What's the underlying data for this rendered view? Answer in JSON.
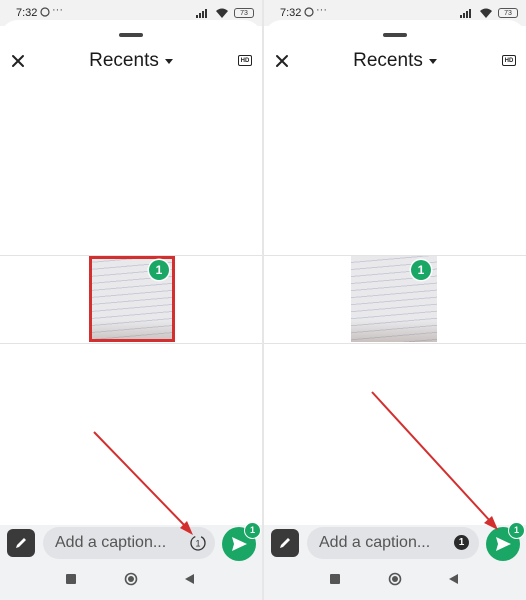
{
  "panels": [
    {
      "status_bar": {
        "time": "7:32",
        "dots": "···",
        "battery": "73"
      },
      "header": {
        "title": "Recents",
        "hd_label": "HD"
      },
      "selection_count": "1",
      "caption": {
        "placeholder": "Add a caption..."
      },
      "send_badge": "1",
      "view_once": {
        "mode": "outline",
        "label": "1"
      },
      "thumbnail_highlighted": true
    },
    {
      "status_bar": {
        "time": "7:32",
        "dots": "···",
        "battery": "73"
      },
      "header": {
        "title": "Recents",
        "hd_label": "HD"
      },
      "selection_count": "1",
      "caption": {
        "placeholder": "Add a caption..."
      },
      "send_badge": "1",
      "view_once": {
        "mode": "filled",
        "label": "1"
      },
      "thumbnail_highlighted": false
    }
  ],
  "colors": {
    "whatsapp_green": "#1aa765",
    "annotation_red": "#d32f2f",
    "bottom_bar_bg": "#f1f2f4",
    "status_bar_bg": "#f2f2f2"
  },
  "icons": {
    "close": "close-icon",
    "dropdown": "caret-down-icon",
    "hd": "hd-icon",
    "edit": "pencil-icon",
    "view_once": "view-once-icon",
    "send": "send-icon",
    "nav_recents": "square-icon",
    "nav_home": "circle-icon",
    "nav_back": "back-triangle-icon"
  }
}
